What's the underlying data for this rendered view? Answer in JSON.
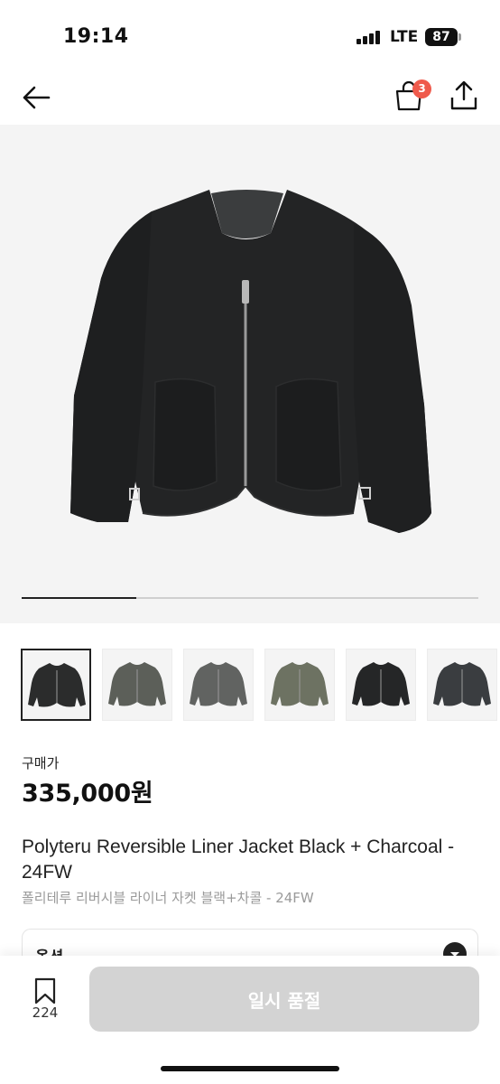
{
  "status_bar": {
    "time": "19:14",
    "network": "LTE",
    "battery": "87"
  },
  "header": {
    "cart_count": "3",
    "back_icon": "arrow-left-icon",
    "cart_icon": "shopping-bag-icon",
    "share_icon": "share-icon"
  },
  "gallery": {
    "progress": 0.25,
    "thumbnails": [
      {
        "color": "#2b2c2c",
        "active": true
      },
      {
        "color": "#5c5f59",
        "active": false
      },
      {
        "color": "#616361",
        "active": false
      },
      {
        "color": "#6d7262",
        "active": false
      },
      {
        "color": "#252627",
        "active": false
      },
      {
        "color": "#3a3d40",
        "active": false
      }
    ]
  },
  "product": {
    "price_label": "구매가",
    "price": "335,000원",
    "title_en": "Polyteru Reversible Liner Jacket Black + Charcoal - 24FW",
    "title_ko": "폴리테루 리버시블 라이너 자켓 블랙+차콜 - 24FW"
  },
  "option": {
    "label": "옵션",
    "icon": "chevron-down-icon"
  },
  "bottom_bar": {
    "bookmark_count": "224",
    "buy_label": "일시 품절",
    "bookmark_icon": "bookmark-icon"
  }
}
